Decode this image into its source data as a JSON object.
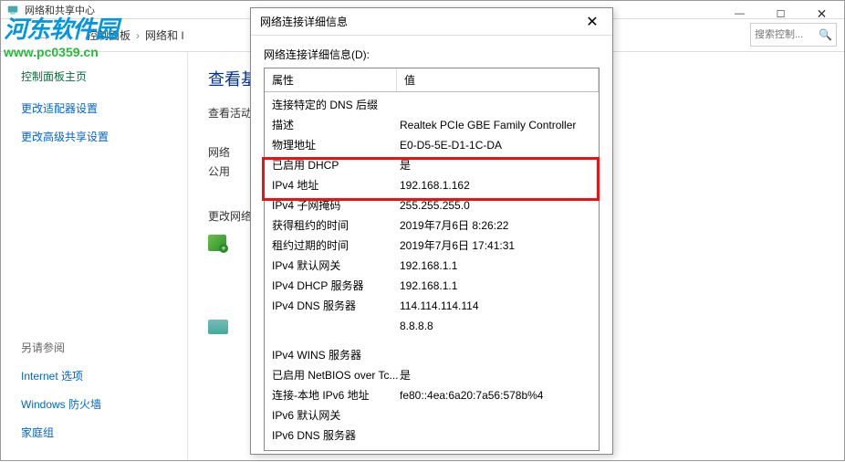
{
  "main": {
    "title": "网络和共享中心",
    "breadcrumb": {
      "back": "←",
      "fwd": "→",
      "up": "↑",
      "item1": "控制面板",
      "item2": "网络和 I",
      "sep": "›"
    },
    "search_placeholder": "搜索控制...",
    "controls": {
      "min": "—",
      "max": "☐",
      "close": "✕"
    }
  },
  "watermark": {
    "logo": "河东软件园",
    "url": "www.pc0359.cn"
  },
  "sidebar": {
    "heading": "控制面板主页",
    "links": [
      "更改适配器设置",
      "更改高级共享设置"
    ],
    "also_label": "另请参阅",
    "also_links": [
      "Internet 选项",
      "Windows 防火墙",
      "家庭组"
    ]
  },
  "area": {
    "big": "查看基",
    "sub": "查看活动",
    "net_label": "网络",
    "pub_label": "公用",
    "change_label": "更改网络"
  },
  "dialog": {
    "title": "网络连接详细信息",
    "close": "✕",
    "label": "网络连接详细信息(D):",
    "header": {
      "prop": "属性",
      "val": "值"
    },
    "rows": [
      {
        "p": "连接特定的 DNS 后缀",
        "v": ""
      },
      {
        "p": "描述",
        "v": "Realtek PCIe GBE Family Controller"
      },
      {
        "p": "物理地址",
        "v": "E0-D5-5E-D1-1C-DA"
      },
      {
        "p": "已启用 DHCP",
        "v": "是"
      },
      {
        "p": "IPv4 地址",
        "v": "192.168.1.162"
      },
      {
        "p": "IPv4 子网掩码",
        "v": "255.255.255.0"
      },
      {
        "p": "获得租约的时间",
        "v": "2019年7月6日 8:26:22"
      },
      {
        "p": "租约过期的时间",
        "v": "2019年7月6日 17:41:31"
      },
      {
        "p": "IPv4 默认网关",
        "v": "192.168.1.1"
      },
      {
        "p": "IPv4 DHCP 服务器",
        "v": "192.168.1.1"
      },
      {
        "p": "IPv4 DNS 服务器",
        "v": "114.114.114.114"
      },
      {
        "p": "",
        "v": "8.8.8.8"
      },
      {
        "p": "IPv4 WINS 服务器",
        "v": ""
      },
      {
        "p": "已启用 NetBIOS over Tc...",
        "v": "是"
      },
      {
        "p": "连接-本地 IPv6 地址",
        "v": "fe80::4ea:6a20:7a56:578b%4"
      },
      {
        "p": "IPv6 默认网关",
        "v": ""
      },
      {
        "p": "IPv6 DNS 服务器",
        "v": ""
      }
    ]
  }
}
